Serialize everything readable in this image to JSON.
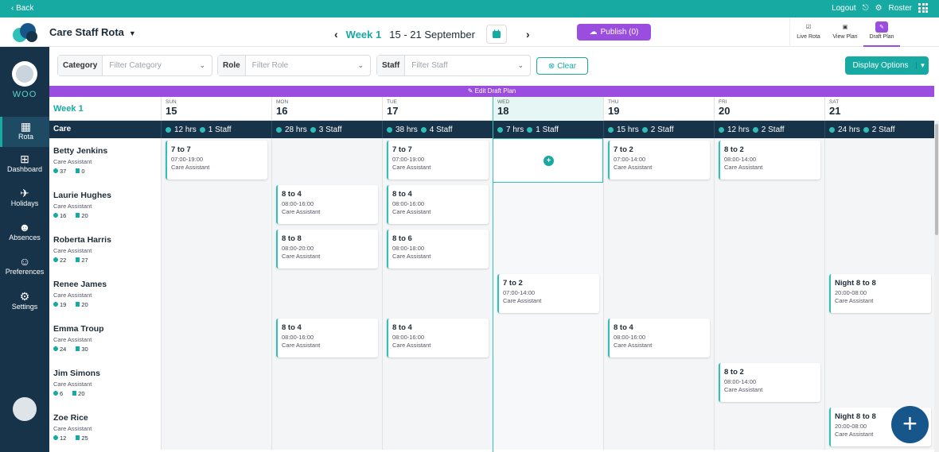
{
  "topbar": {
    "back": "Back",
    "logout": "Logout",
    "roster": "Roster"
  },
  "header": {
    "title": "Care Staff Rota",
    "week_label": "Week 1",
    "date_range": "15 - 21 September",
    "publish": "Publish (0)",
    "modes": [
      "Live Rota",
      "View Plan",
      "Draft Plan"
    ]
  },
  "sidebar": {
    "org": "WOO",
    "nav": [
      "Rota",
      "Dashboard",
      "Holidays",
      "Absences",
      "Preferences",
      "Settings"
    ]
  },
  "filters": {
    "category_label": "Category",
    "category_ph": "Filter Category",
    "role_label": "Role",
    "role_ph": "Filter Role",
    "staff_label": "Staff",
    "staff_ph": "Filter Staff",
    "clear": "Clear",
    "display": "Display Options"
  },
  "draft_bar": "Edit Draft Plan",
  "grid": {
    "week": "Week 1",
    "category": "Care",
    "days": [
      {
        "n": "SUN",
        "d": "15",
        "hrs": "12 hrs",
        "staff": "1 Staff"
      },
      {
        "n": "MON",
        "d": "16",
        "hrs": "28 hrs",
        "staff": "3 Staff"
      },
      {
        "n": "TUE",
        "d": "17",
        "hrs": "38 hrs",
        "staff": "4 Staff"
      },
      {
        "n": "WED",
        "d": "18",
        "hrs": "7 hrs",
        "staff": "1 Staff"
      },
      {
        "n": "THU",
        "d": "19",
        "hrs": "15 hrs",
        "staff": "2 Staff"
      },
      {
        "n": "FRI",
        "d": "20",
        "hrs": "12 hrs",
        "staff": "2 Staff"
      },
      {
        "n": "SAT",
        "d": "21",
        "hrs": "24 hrs",
        "staff": "2 Staff"
      }
    ],
    "staff": [
      {
        "name": "Betty Jenkins",
        "role": "Care Assistant",
        "a": "37",
        "b": "0",
        "shifts": [
          {
            "day": 0,
            "t": "7 to 7",
            "h": "07:00-19:00"
          },
          {
            "day": 2,
            "t": "7 to 7",
            "h": "07:00-19:00"
          },
          {
            "day": 4,
            "t": "7 to 2",
            "h": "07:00-14:00"
          },
          {
            "day": 5,
            "t": "8 to 2",
            "h": "08:00-14:00"
          }
        ]
      },
      {
        "name": "Laurie Hughes",
        "role": "Care Assistant",
        "a": "16",
        "b": "20",
        "shifts": [
          {
            "day": 1,
            "t": "8 to 4",
            "h": "08:00-16:00"
          },
          {
            "day": 2,
            "t": "8 to 4",
            "h": "08:00-16:00"
          }
        ]
      },
      {
        "name": "Roberta Harris",
        "role": "Care Assistant",
        "a": "22",
        "b": "27",
        "shifts": [
          {
            "day": 1,
            "t": "8 to 8",
            "h": "08:00-20:00"
          },
          {
            "day": 2,
            "t": "8 to 6",
            "h": "08:00-18:00"
          }
        ]
      },
      {
        "name": "Renee James",
        "role": "Care Assistant",
        "a": "19",
        "b": "20",
        "shifts": [
          {
            "day": 3,
            "t": "7 to 2",
            "h": "07:00-14:00"
          },
          {
            "day": 6,
            "t": "Night 8 to 8",
            "h": "20:00-08:00"
          }
        ]
      },
      {
        "name": "Emma Troup",
        "role": "Care Assistant",
        "a": "24",
        "b": "30",
        "shifts": [
          {
            "day": 1,
            "t": "8 to 4",
            "h": "08:00-16:00"
          },
          {
            "day": 2,
            "t": "8 to 4",
            "h": "08:00-16:00"
          },
          {
            "day": 4,
            "t": "8 to 4",
            "h": "08:00-16:00"
          }
        ]
      },
      {
        "name": "Jim Simons",
        "role": "Care Assistant",
        "a": "6",
        "b": "20",
        "shifts": [
          {
            "day": 5,
            "t": "8 to 2",
            "h": "08:00-14:00"
          }
        ]
      },
      {
        "name": "Zoe Rice",
        "role": "Care Assistant",
        "a": "12",
        "b": "25",
        "shifts": [
          {
            "day": 6,
            "t": "Night 8 to 8",
            "h": "20:00-08:00"
          }
        ]
      }
    ],
    "shift_role": "Care Assistant"
  }
}
